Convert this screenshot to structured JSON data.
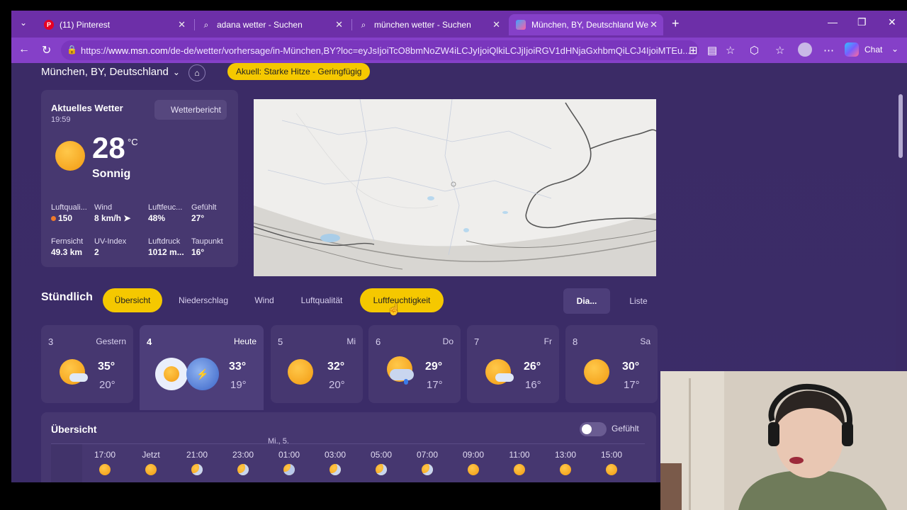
{
  "tabs": [
    {
      "label": "(11) Pinterest",
      "icon": "pinterest-icon"
    },
    {
      "label": "adana wetter - Suchen",
      "icon": "search-icon"
    },
    {
      "label": "münchen wetter - Suchen",
      "icon": "search-icon"
    },
    {
      "label": "München, BY, Deutschland Wetter",
      "icon": "msn-icon"
    }
  ],
  "address": {
    "url_prefix": "https://",
    "url_host": "www.msn.com",
    "url_rest": "/de-de/wetter/vorhersage/in-München,BY?loc=eyJsIjoiTcO8bmNoZW4iLCJyIjoiQlkiLCJjIjoiRGV1dHNjaGxhbmQiLCJ4IjoiMTEu..."
  },
  "chat_label": "Chat",
  "location": {
    "name": "München, BY, Deutschland"
  },
  "alert": "Akuell: Starke Hitze - Geringfügig",
  "current": {
    "title": "Aktuelles Wetter",
    "time": "19:59",
    "report_button": "Wetterbericht",
    "temp": "28",
    "unit": "°C",
    "condition": "Sonnig",
    "stats": [
      {
        "label": "Luftquali...",
        "value": "150"
      },
      {
        "label": "Wind",
        "value": "8 km/h"
      },
      {
        "label": "Luftfeuc...",
        "value": "48%"
      },
      {
        "label": "Gefühlt",
        "value": "27°"
      },
      {
        "label": "Fernsicht",
        "value": "49.3 km"
      },
      {
        "label": "UV-Index",
        "value": "2"
      },
      {
        "label": "Luftdruck",
        "value": "1012 m..."
      },
      {
        "label": "Taupunkt",
        "value": "16°"
      }
    ]
  },
  "hourly": {
    "title": "Stündlich",
    "pills": [
      "Übersicht",
      "Niederschlag",
      "Wind",
      "Luftqualität",
      "Luftfeuchtigkeit"
    ],
    "views": [
      "Dia...",
      "Liste"
    ]
  },
  "days": [
    {
      "num": "3",
      "label": "Gestern",
      "hi": "35°",
      "lo": "20°",
      "icon": "partly-cloudy-icon"
    },
    {
      "num": "4",
      "label": "Heute",
      "hi": "33°",
      "lo": "19°",
      "icon": "sun-icon"
    },
    {
      "num": "5",
      "label": "Mi",
      "hi": "32°",
      "lo": "20°",
      "icon": "sun-icon"
    },
    {
      "num": "6",
      "label": "Do",
      "hi": "29°",
      "lo": "17°",
      "icon": "rain-cloud-icon"
    },
    {
      "num": "7",
      "label": "Fr",
      "hi": "26°",
      "lo": "16°",
      "icon": "partly-cloudy-icon"
    },
    {
      "num": "8",
      "label": "Sa",
      "hi": "30°",
      "lo": "17°",
      "icon": "sun-icon"
    }
  ],
  "overview": {
    "title": "Übersicht",
    "toggle_label": "Gefühlt",
    "date_label": "Mi., 5.",
    "hours": [
      "17:00",
      "Jetzt",
      "21:00",
      "23:00",
      "01:00",
      "03:00",
      "05:00",
      "07:00",
      "09:00",
      "11:00",
      "13:00",
      "15:00"
    ]
  },
  "colors": {
    "accent": "#f5c800",
    "tabbar": "#6d2fa8",
    "page": "#3b2b66"
  }
}
